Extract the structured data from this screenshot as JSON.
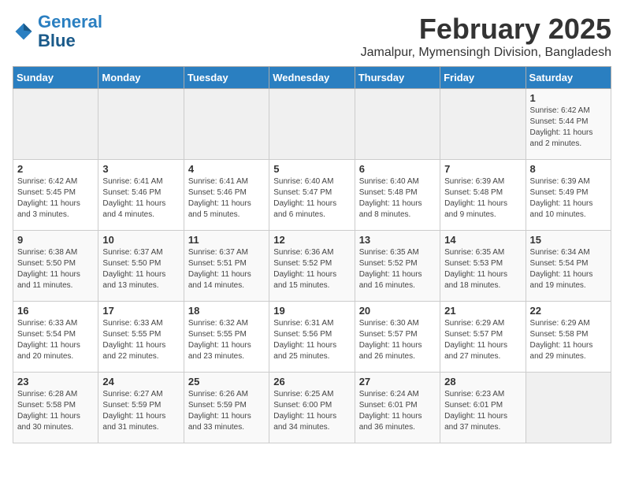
{
  "header": {
    "logo_line1": "General",
    "logo_line2": "Blue",
    "title": "February 2025",
    "subtitle": "Jamalpur, Mymensingh Division, Bangladesh"
  },
  "days_of_week": [
    "Sunday",
    "Monday",
    "Tuesday",
    "Wednesday",
    "Thursday",
    "Friday",
    "Saturday"
  ],
  "weeks": [
    [
      {
        "day": "",
        "info": ""
      },
      {
        "day": "",
        "info": ""
      },
      {
        "day": "",
        "info": ""
      },
      {
        "day": "",
        "info": ""
      },
      {
        "day": "",
        "info": ""
      },
      {
        "day": "",
        "info": ""
      },
      {
        "day": "1",
        "info": "Sunrise: 6:42 AM\nSunset: 5:44 PM\nDaylight: 11 hours\nand 2 minutes."
      }
    ],
    [
      {
        "day": "2",
        "info": "Sunrise: 6:42 AM\nSunset: 5:45 PM\nDaylight: 11 hours\nand 3 minutes."
      },
      {
        "day": "3",
        "info": "Sunrise: 6:41 AM\nSunset: 5:46 PM\nDaylight: 11 hours\nand 4 minutes."
      },
      {
        "day": "4",
        "info": "Sunrise: 6:41 AM\nSunset: 5:46 PM\nDaylight: 11 hours\nand 5 minutes."
      },
      {
        "day": "5",
        "info": "Sunrise: 6:40 AM\nSunset: 5:47 PM\nDaylight: 11 hours\nand 6 minutes."
      },
      {
        "day": "6",
        "info": "Sunrise: 6:40 AM\nSunset: 5:48 PM\nDaylight: 11 hours\nand 8 minutes."
      },
      {
        "day": "7",
        "info": "Sunrise: 6:39 AM\nSunset: 5:48 PM\nDaylight: 11 hours\nand 9 minutes."
      },
      {
        "day": "8",
        "info": "Sunrise: 6:39 AM\nSunset: 5:49 PM\nDaylight: 11 hours\nand 10 minutes."
      }
    ],
    [
      {
        "day": "9",
        "info": "Sunrise: 6:38 AM\nSunset: 5:50 PM\nDaylight: 11 hours\nand 11 minutes."
      },
      {
        "day": "10",
        "info": "Sunrise: 6:37 AM\nSunset: 5:50 PM\nDaylight: 11 hours\nand 13 minutes."
      },
      {
        "day": "11",
        "info": "Sunrise: 6:37 AM\nSunset: 5:51 PM\nDaylight: 11 hours\nand 14 minutes."
      },
      {
        "day": "12",
        "info": "Sunrise: 6:36 AM\nSunset: 5:52 PM\nDaylight: 11 hours\nand 15 minutes."
      },
      {
        "day": "13",
        "info": "Sunrise: 6:35 AM\nSunset: 5:52 PM\nDaylight: 11 hours\nand 16 minutes."
      },
      {
        "day": "14",
        "info": "Sunrise: 6:35 AM\nSunset: 5:53 PM\nDaylight: 11 hours\nand 18 minutes."
      },
      {
        "day": "15",
        "info": "Sunrise: 6:34 AM\nSunset: 5:54 PM\nDaylight: 11 hours\nand 19 minutes."
      }
    ],
    [
      {
        "day": "16",
        "info": "Sunrise: 6:33 AM\nSunset: 5:54 PM\nDaylight: 11 hours\nand 20 minutes."
      },
      {
        "day": "17",
        "info": "Sunrise: 6:33 AM\nSunset: 5:55 PM\nDaylight: 11 hours\nand 22 minutes."
      },
      {
        "day": "18",
        "info": "Sunrise: 6:32 AM\nSunset: 5:55 PM\nDaylight: 11 hours\nand 23 minutes."
      },
      {
        "day": "19",
        "info": "Sunrise: 6:31 AM\nSunset: 5:56 PM\nDaylight: 11 hours\nand 25 minutes."
      },
      {
        "day": "20",
        "info": "Sunrise: 6:30 AM\nSunset: 5:57 PM\nDaylight: 11 hours\nand 26 minutes."
      },
      {
        "day": "21",
        "info": "Sunrise: 6:29 AM\nSunset: 5:57 PM\nDaylight: 11 hours\nand 27 minutes."
      },
      {
        "day": "22",
        "info": "Sunrise: 6:29 AM\nSunset: 5:58 PM\nDaylight: 11 hours\nand 29 minutes."
      }
    ],
    [
      {
        "day": "23",
        "info": "Sunrise: 6:28 AM\nSunset: 5:58 PM\nDaylight: 11 hours\nand 30 minutes."
      },
      {
        "day": "24",
        "info": "Sunrise: 6:27 AM\nSunset: 5:59 PM\nDaylight: 11 hours\nand 31 minutes."
      },
      {
        "day": "25",
        "info": "Sunrise: 6:26 AM\nSunset: 5:59 PM\nDaylight: 11 hours\nand 33 minutes."
      },
      {
        "day": "26",
        "info": "Sunrise: 6:25 AM\nSunset: 6:00 PM\nDaylight: 11 hours\nand 34 minutes."
      },
      {
        "day": "27",
        "info": "Sunrise: 6:24 AM\nSunset: 6:01 PM\nDaylight: 11 hours\nand 36 minutes."
      },
      {
        "day": "28",
        "info": "Sunrise: 6:23 AM\nSunset: 6:01 PM\nDaylight: 11 hours\nand 37 minutes."
      },
      {
        "day": "",
        "info": ""
      }
    ]
  ]
}
